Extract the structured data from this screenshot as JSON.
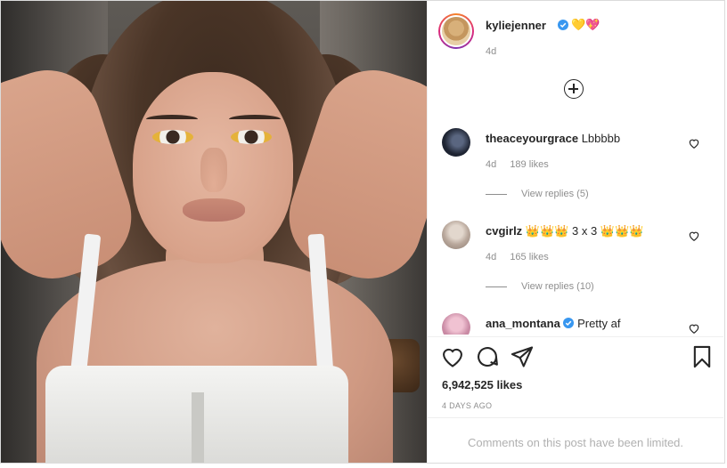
{
  "post": {
    "author": {
      "username": "kyliejenner",
      "verified_icon": "verified-badge-icon",
      "name_emoji": "💛💖",
      "post_age": "4d",
      "avatar_icon": "profile-avatar"
    },
    "load_more_icon": "plus-circle-icon",
    "comments": [
      {
        "username": "theaceyourgrace",
        "text": "Lbbbbb",
        "age": "4d",
        "likes": "189 likes",
        "view_replies": "View replies (5)",
        "avatar_color": "#2a3140",
        "verified": false
      },
      {
        "username": "cvgirlz",
        "text": "👑👑👑 3 x 3 👑👑👑",
        "age": "4d",
        "likes": "165 likes",
        "view_replies": "View replies (10)",
        "avatar_color": "#cfc2b8",
        "verified": false
      },
      {
        "username": "ana_montana",
        "text": "Pretty af",
        "verified": true,
        "avatar_color": "#d7a0b5"
      }
    ],
    "actions": {
      "like_icon": "heart-icon",
      "comment_icon": "comment-icon",
      "share_icon": "paper-plane-icon",
      "save_icon": "bookmark-icon"
    },
    "likes_count": "6,942,525 likes",
    "posted_ago": "4 DAYS AGO",
    "comments_limited": "Comments on this post have been limited.",
    "colors": {
      "verified_blue": "#3897f0",
      "text_primary": "#262626",
      "text_secondary": "#8e8e8e"
    }
  }
}
